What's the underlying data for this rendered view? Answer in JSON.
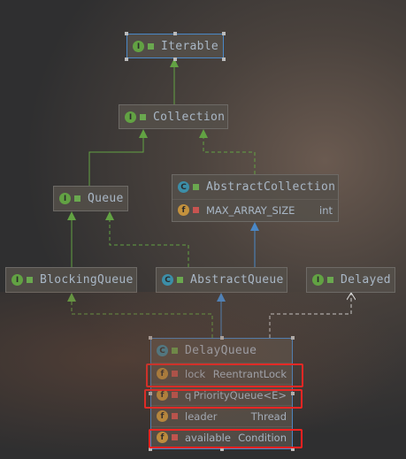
{
  "nodes": {
    "iterable": {
      "name": "Iterable",
      "kind": "I"
    },
    "collection": {
      "name": "Collection",
      "kind": "I"
    },
    "queue": {
      "name": "Queue",
      "kind": "I"
    },
    "abstract_collection": {
      "name": "AbstractCollection",
      "kind": "C",
      "fields": [
        {
          "name": "MAX_ARRAY_SIZE",
          "type": "int"
        }
      ]
    },
    "blocking_queue": {
      "name": "BlockingQueue",
      "kind": "I"
    },
    "abstract_queue": {
      "name": "AbstractQueue",
      "kind": "C"
    },
    "delayed": {
      "name": "Delayed",
      "kind": "I"
    },
    "delay_queue": {
      "name": "DelayQueue",
      "kind": "C",
      "fields": [
        {
          "name": "lock",
          "type": "ReentrantLock"
        },
        {
          "name": "q",
          "type": "PriorityQueue<E>"
        },
        {
          "name": "leader",
          "type": "Thread"
        },
        {
          "name": "available",
          "type": "Condition"
        }
      ]
    }
  },
  "field_icon": "f",
  "colors": {
    "interface": "#62a243",
    "class": "#3c8ea8",
    "extends": "#4a88c7",
    "highlight": "#ff2020"
  }
}
